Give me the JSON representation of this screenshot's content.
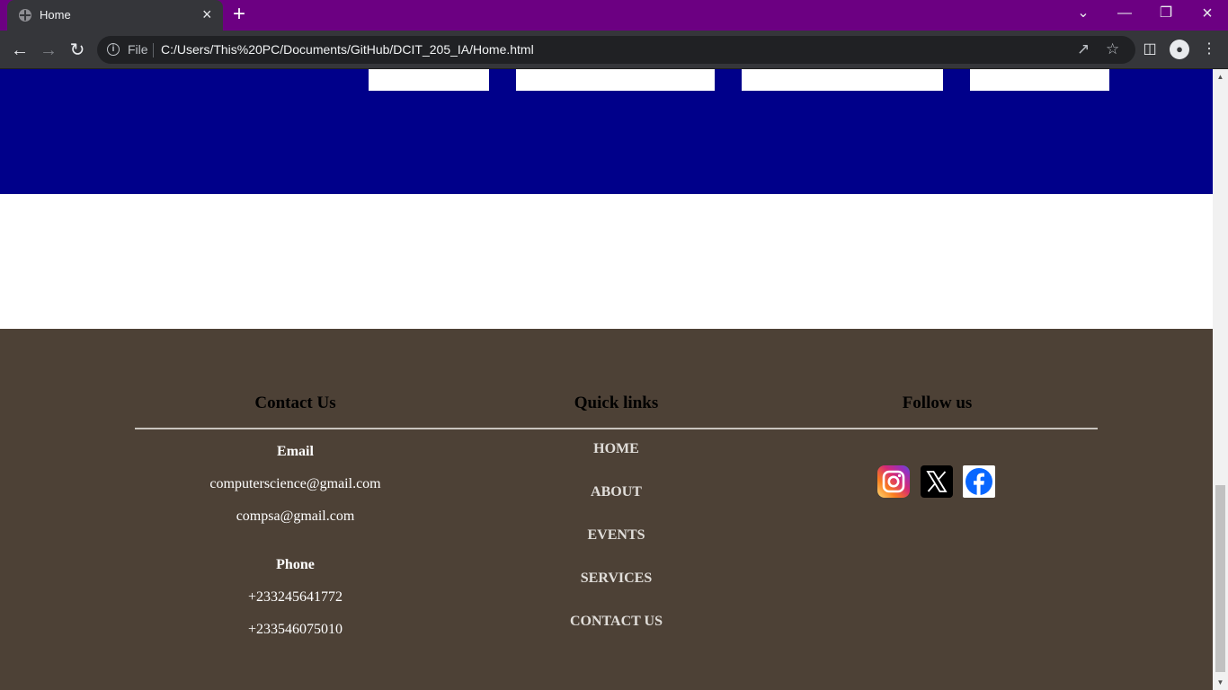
{
  "browser": {
    "tab_title": "Home",
    "scheme_label": "File",
    "url": "C:/Users/This%20PC/Documents/GitHub/DCIT_205_IA/Home.html",
    "titlebar_color": "#6c0082"
  },
  "page": {
    "band_color": "#00008a",
    "footer_color": "#4d4136"
  },
  "footer": {
    "contact": {
      "heading": "Contact Us",
      "email_label": "Email",
      "emails": [
        "computerscience@gmail.com",
        "compsa@gmail.com"
      ],
      "phone_label": "Phone",
      "phones": [
        "+233245641772",
        "+233546075010"
      ]
    },
    "quick_links": {
      "heading": "Quick links",
      "links": [
        "HOME",
        "ABOUT",
        "EVENTS",
        "SERVICES",
        "CONTACT US"
      ]
    },
    "follow": {
      "heading": "Follow us",
      "icons": [
        "instagram-icon",
        "x-twitter-icon",
        "facebook-icon"
      ]
    }
  }
}
